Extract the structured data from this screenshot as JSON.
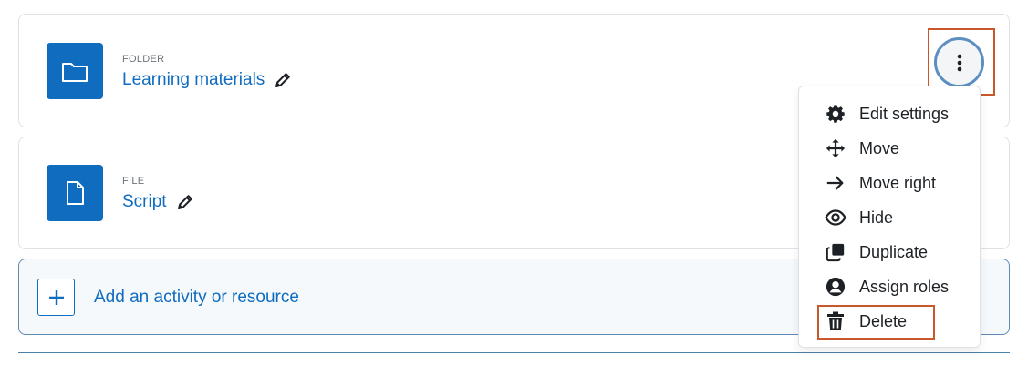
{
  "resources": [
    {
      "type": "FOLDER",
      "name": "Learning materials",
      "icon": "folder-icon"
    },
    {
      "type": "FILE",
      "name": "Script",
      "icon": "file-icon"
    }
  ],
  "add_activity": {
    "label": "Add an activity or resource",
    "icon": "plus-icon"
  },
  "action_menu": {
    "items": [
      {
        "label": "Edit settings",
        "icon": "gear-icon"
      },
      {
        "label": "Move",
        "icon": "move-arrows-icon"
      },
      {
        "label": "Move right",
        "icon": "arrow-right-icon"
      },
      {
        "label": "Hide",
        "icon": "eye-icon"
      },
      {
        "label": "Duplicate",
        "icon": "duplicate-icon"
      },
      {
        "label": "Assign roles",
        "icon": "user-circle-icon"
      },
      {
        "label": "Delete",
        "icon": "trash-icon"
      }
    ]
  },
  "colors": {
    "accent": "#0f6cbf",
    "highlight": "#c8582c",
    "text": "#1d2125"
  }
}
